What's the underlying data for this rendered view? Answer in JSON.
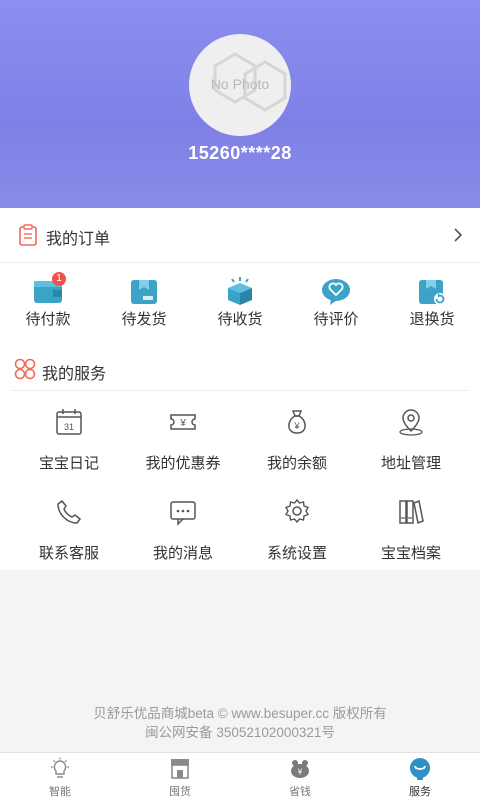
{
  "profile": {
    "avatar_placeholder": "No Photo",
    "phone": "15260****28"
  },
  "orders": {
    "title": "我的订单",
    "items": [
      {
        "label": "待付款",
        "badge": "1",
        "icon": "wallet-icon"
      },
      {
        "label": "待发货",
        "icon": "package-ship-icon"
      },
      {
        "label": "待收货",
        "icon": "box-open-icon"
      },
      {
        "label": "待评价",
        "icon": "heart-chat-icon"
      },
      {
        "label": "退换货",
        "icon": "return-box-icon"
      }
    ]
  },
  "services": {
    "title": "我的服务",
    "items": [
      {
        "label": "宝宝日记",
        "icon": "calendar-icon",
        "calendar_day": "31"
      },
      {
        "label": "我的优惠券",
        "icon": "coupon-icon"
      },
      {
        "label": "我的余额",
        "icon": "money-bag-icon"
      },
      {
        "label": "地址管理",
        "icon": "location-icon"
      },
      {
        "label": "联系客服",
        "icon": "phone-icon"
      },
      {
        "label": "我的消息",
        "icon": "message-icon"
      },
      {
        "label": "系统设置",
        "icon": "gear-icon"
      },
      {
        "label": "宝宝档案",
        "icon": "archive-icon"
      }
    ]
  },
  "footer": {
    "line1": "贝舒乐优品商城beta © www.besuper.cc 版权所有",
    "line2": "闽公网安备 35052102000321号"
  },
  "tabbar": {
    "items": [
      {
        "label": "智能",
        "icon": "bulb-icon",
        "active": false
      },
      {
        "label": "囤货",
        "icon": "store-icon",
        "active": false
      },
      {
        "label": "省钱",
        "icon": "piggy-icon",
        "active": false
      },
      {
        "label": "服务",
        "icon": "service-icon",
        "active": true
      }
    ]
  },
  "colors": {
    "header_gradient": "#8c8ef0",
    "order_icon_teal": "#3aa3c6",
    "badge_red": "#f0524a",
    "service_icon_accent": "#ef6b5a"
  }
}
